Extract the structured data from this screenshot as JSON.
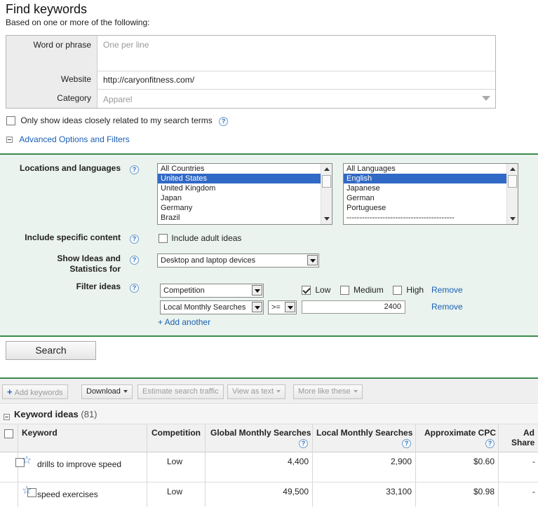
{
  "header": {
    "title": "Find keywords",
    "subtitle": "Based on one or more of the following:"
  },
  "inputs": {
    "word_label": "Word or phrase",
    "word_placeholder": "One per line",
    "website_label": "Website",
    "website_value": "http://caryonfitness.com/",
    "category_label": "Category",
    "category_value": "Apparel"
  },
  "only_related": {
    "label": "Only show ideas closely related to my search terms",
    "checked": false
  },
  "advanced_toggle": "Advanced Options and Filters",
  "advanced": {
    "locations_label": "Locations and languages",
    "countries": [
      "All Countries",
      "United States",
      "United Kingdom",
      "Japan",
      "Germany",
      "Brazil"
    ],
    "countries_selected": "United States",
    "languages": [
      "All Languages",
      "English",
      "Japanese",
      "German",
      "Portuguese",
      "------------------------------------------"
    ],
    "languages_selected": "English",
    "specific_label": "Include specific content",
    "adult_label": "Include adult ideas",
    "show_ideas_label_1": "Show Ideas and",
    "show_ideas_label_2": "Statistics for",
    "device_value": "Desktop and laptop devices",
    "filter_label": "Filter ideas",
    "filter1": {
      "field": "Competition",
      "low": "Low",
      "low_checked": true,
      "medium": "Medium",
      "medium_checked": false,
      "high": "High",
      "high_checked": false,
      "remove": "Remove"
    },
    "filter2": {
      "field": "Local Monthly Searches",
      "operator": ">=",
      "value": "2400",
      "remove": "Remove"
    },
    "add_another": "+ Add another"
  },
  "search_button": "Search",
  "toolbar": {
    "add_keywords": "Add keywords",
    "download": "Download",
    "estimate": "Estimate search traffic",
    "view_as_text": "View as text",
    "more_like": "More like these"
  },
  "keyword_ideas": {
    "title": "Keyword ideas",
    "count": "(81)"
  },
  "table": {
    "headers": {
      "keyword": "Keyword",
      "competition": "Competition",
      "global": "Global Monthly Searches",
      "local": "Local Monthly Searches",
      "cpc": "Approximate CPC",
      "ad_share_1": "Ad",
      "ad_share_2": "Share"
    },
    "rows": [
      {
        "keyword": "drills to improve speed",
        "competition": "Low",
        "global": "4,400",
        "local": "2,900",
        "cpc": "$0.60",
        "ad_share": "-"
      },
      {
        "keyword": "speed exercises",
        "competition": "Low",
        "global": "49,500",
        "local": "33,100",
        "cpc": "$0.98",
        "ad_share": "-"
      }
    ]
  },
  "icons": {
    "help": "question-mark-icon",
    "star": "star-icon",
    "collapse": "minus-box-icon"
  },
  "colors": {
    "panel_bg": "#eaf3ee",
    "panel_border": "#3c8a4d",
    "link": "#1a5fb4",
    "selection": "#3169c6"
  }
}
